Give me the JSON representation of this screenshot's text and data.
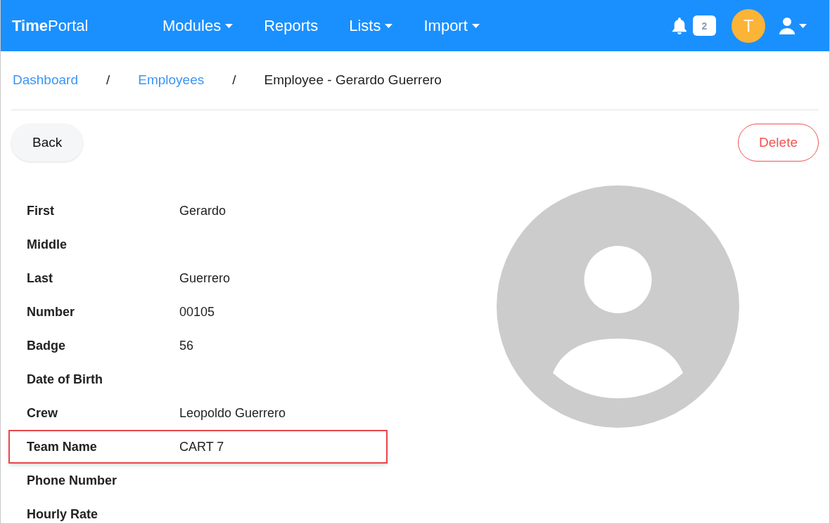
{
  "navbar": {
    "brand": {
      "bold": "Time",
      "regular": "Portal"
    },
    "menu": [
      {
        "label": "Modules",
        "dropdown": true
      },
      {
        "label": "Reports",
        "dropdown": false
      },
      {
        "label": "Lists",
        "dropdown": true
      },
      {
        "label": "Import",
        "dropdown": true
      }
    ],
    "notifications": {
      "count": "2"
    },
    "user_initial": "T"
  },
  "breadcrumb": [
    {
      "label": "Dashboard",
      "link": true
    },
    {
      "label": "Employees",
      "link": true
    },
    {
      "label": "Employee - Gerardo Guerrero",
      "link": false
    }
  ],
  "separator": "/",
  "actions": {
    "back": "Back",
    "delete": "Delete"
  },
  "fields": [
    {
      "label": "First",
      "value": "Gerardo",
      "highlighted": false
    },
    {
      "label": "Middle",
      "highlighted": false
    },
    {
      "label": "Last",
      "value": "Guerrero",
      "highlighted": false
    },
    {
      "label": "Number",
      "value": "00105",
      "highlighted": false
    },
    {
      "label": "Badge",
      "value": "56",
      "highlighted": false
    },
    {
      "label": "Date of Birth",
      "highlighted": false
    },
    {
      "label": "Crew",
      "value": "Leopoldo Guerrero",
      "highlighted": false
    },
    {
      "label": "Team Name",
      "value": "CART 7",
      "highlighted": true
    },
    {
      "label": "Phone Number",
      "highlighted": false
    },
    {
      "label": "Hourly Rate",
      "highlighted": false
    }
  ]
}
